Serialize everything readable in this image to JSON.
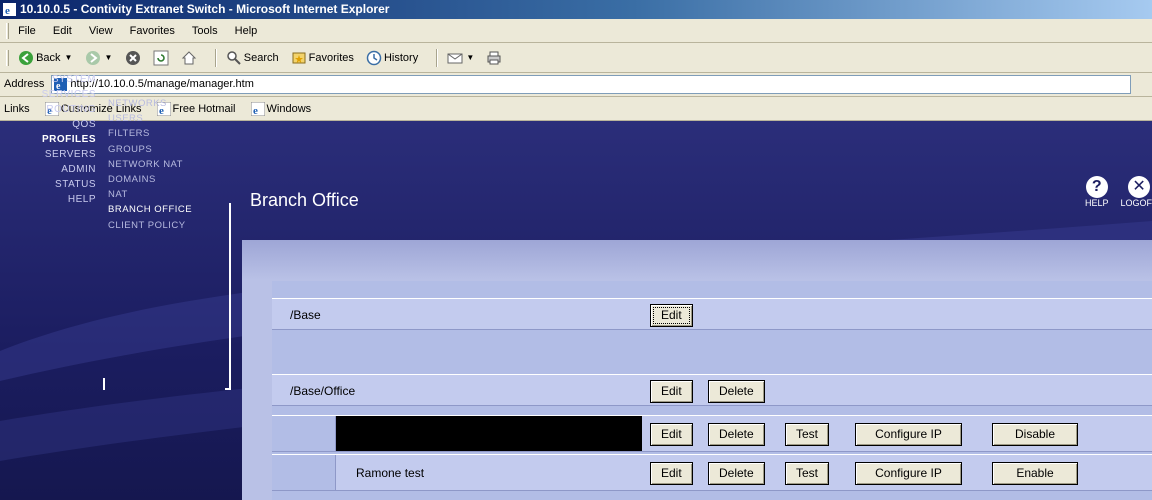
{
  "browser": {
    "title": "10.10.0.5 - Contivity Extranet Switch - Microsoft Internet Explorer",
    "menu": [
      "File",
      "Edit",
      "View",
      "Favorites",
      "Tools",
      "Help"
    ],
    "toolbar": {
      "back": "Back",
      "search": "Search",
      "favorites": "Favorites",
      "history": "History"
    },
    "address": {
      "label": "Address",
      "url": "http://10.10.0.5/manage/manager.htm"
    },
    "links": {
      "label": "Links",
      "items": [
        "Customize Links",
        "Free Hotmail",
        "Windows"
      ]
    }
  },
  "nav": {
    "main": [
      "SYSTEM",
      "SERVICES",
      "ROUTING",
      "QOS",
      "PROFILES",
      "SERVERS",
      "ADMIN",
      "STATUS",
      "HELP"
    ],
    "main_active": "PROFILES",
    "sub": [
      "NETWORKS",
      "USERS",
      "FILTERS",
      "GROUPS",
      "NETWORK NAT",
      "DOMAINS",
      "NAT",
      "BRANCH OFFICE",
      "CLIENT POLICY"
    ],
    "sub_active": "BRANCH OFFICE"
  },
  "page": {
    "title": "Branch Office",
    "help_label": "HELP",
    "logoff_label": "LOGOFF"
  },
  "rows": {
    "base": {
      "label": "/Base",
      "edit": "Edit"
    },
    "office": {
      "label": "/Base/Office",
      "edit": "Edit",
      "delete": "Delete"
    },
    "conn1": {
      "label": "",
      "edit": "Edit",
      "delete": "Delete",
      "test": "Test",
      "configure_ip": "Configure IP",
      "toggle": "Disable"
    },
    "conn2": {
      "label": "Ramone test",
      "edit": "Edit",
      "delete": "Delete",
      "test": "Test",
      "configure_ip": "Configure IP",
      "toggle": "Enable"
    }
  },
  "colors": {
    "banner": "#1b1d60",
    "panel": "#b9c1e6",
    "titlebar": "#0a246a"
  }
}
